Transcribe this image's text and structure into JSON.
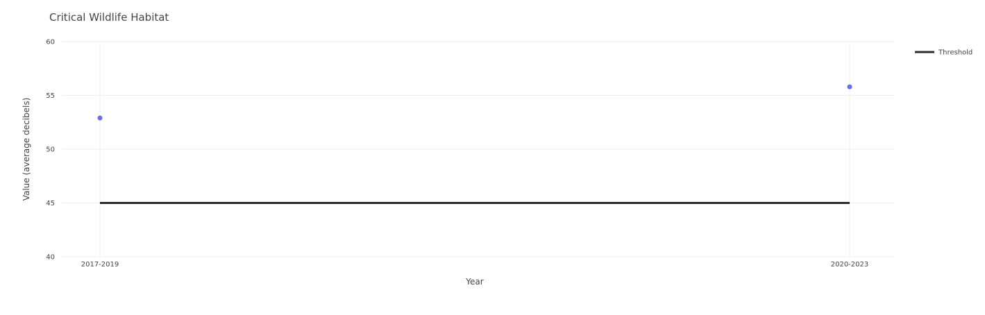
{
  "chart_data": {
    "type": "scatter",
    "title": "Critical Wildlife Habitat",
    "xlabel": "Year",
    "ylabel": "Value (average decibels)",
    "categories": [
      "2017-2019",
      "2020-2023"
    ],
    "ylim": [
      40,
      60
    ],
    "yticks": [
      40,
      45,
      50,
      55,
      60
    ],
    "grid": true,
    "legend_position": "top-right",
    "series": [
      {
        "type": "scatter",
        "values": [
          52.9,
          55.8
        ],
        "color": "#636efa"
      },
      {
        "name": "Threshold",
        "type": "line",
        "values": [
          45,
          45
        ],
        "color": "#2b2b2b"
      }
    ]
  }
}
